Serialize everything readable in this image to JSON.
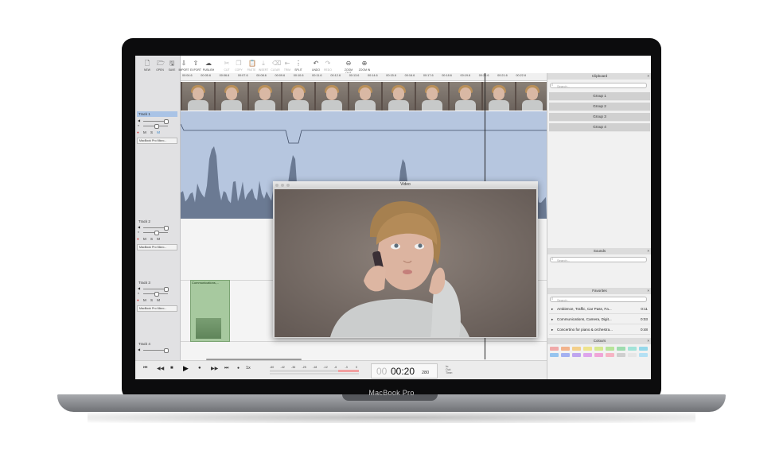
{
  "device": {
    "brand": "MacBook Pro"
  },
  "toolbar": [
    {
      "label": "NEW",
      "icon": "new-file-icon",
      "enabled": true
    },
    {
      "label": "OPEN",
      "icon": "open-file-icon",
      "enabled": true
    },
    {
      "label": "SAVE",
      "icon": "save-icon",
      "enabled": true
    },
    {
      "label": "IMPORT",
      "icon": "import-icon",
      "enabled": true
    },
    {
      "label": "EXPORT",
      "icon": "export-icon",
      "enabled": true
    },
    {
      "label": "PUBLISH",
      "icon": "publish-cloud-icon",
      "enabled": true
    },
    {
      "label": "CUT",
      "icon": "scissors-icon",
      "enabled": false
    },
    {
      "label": "COPY",
      "icon": "copy-icon",
      "enabled": false
    },
    {
      "label": "PASTE",
      "icon": "paste-icon",
      "enabled": false
    },
    {
      "label": "INSERT",
      "icon": "insert-icon",
      "enabled": false
    },
    {
      "label": "CLEAR",
      "icon": "clear-icon",
      "enabled": false
    },
    {
      "label": "TRIM",
      "icon": "trim-icon",
      "enabled": false
    },
    {
      "label": "SPLIT",
      "icon": "split-icon",
      "enabled": true
    },
    {
      "label": "UNDO",
      "icon": "undo-icon",
      "enabled": true
    },
    {
      "label": "REDO",
      "icon": "redo-icon",
      "enabled": false
    },
    {
      "label": "ZOOM OUT",
      "icon": "zoom-out-icon",
      "enabled": true
    },
    {
      "label": "ZOOM IN",
      "icon": "zoom-in-icon",
      "enabled": true
    }
  ],
  "ruler": [
    "00:04.6",
    "00:05.6",
    "00:06.6",
    "00:07.6",
    "00:08.6",
    "00:09.6",
    "00:10.6",
    "00:11.6",
    "00:12.6",
    "00:13.6",
    "00:14.6",
    "00:15.6",
    "00:16.6",
    "00:17.6",
    "00:18.6",
    "00:19.6",
    "00:20.6",
    "00:21.6",
    "00:22.6"
  ],
  "tracks": [
    {
      "title": "Track 1",
      "device": "MacBook Pro Micro...",
      "selected": true
    },
    {
      "title": "Track 2",
      "device": "MacBook Pro Micro...",
      "selected": false
    },
    {
      "title": "Track 3",
      "device": "MacBook Pro Micro...",
      "selected": false
    },
    {
      "title": "Track 4",
      "device": "",
      "selected": false
    }
  ],
  "track_buttons": {
    "record": "●",
    "mute": "M",
    "solo": "S",
    "monitor": "M"
  },
  "clip3": {
    "title": "Communications,..."
  },
  "video_window": {
    "title": "Video"
  },
  "clipboard": {
    "title": "Clipboard",
    "search_placeholder": "Search...",
    "groups": [
      "Group 1",
      "Group 2",
      "Group 3",
      "Group 4"
    ]
  },
  "sounds": {
    "title": "Sounds",
    "search_placeholder": "Search..."
  },
  "favorites": {
    "title": "Favorites",
    "search_placeholder": "Search...",
    "items": [
      {
        "name": "Ambience, Traffic, Car Pass, Fa...",
        "duration": "0:11"
      },
      {
        "name": "Communications, Camera, Digit...",
        "duration": "0:03"
      },
      {
        "name": "Concertino for piano & orchestra...",
        "duration": "0:48"
      }
    ]
  },
  "colours": {
    "title": "Colours",
    "swatches": [
      "#f0a9a9",
      "#f2b38c",
      "#f3cf8a",
      "#eee38c",
      "#d6e88e",
      "#b7e49a",
      "#9edcaf",
      "#a3e3d8",
      "#95d8ea",
      "#96c4ef",
      "#a3b0f1",
      "#bfa5ef",
      "#dea5ec",
      "#f0a5d8",
      "#f6b4c4",
      "#cfcfcf",
      "#e6e6e6",
      "#b4e0f4"
    ]
  },
  "transport": {
    "speed": "1x",
    "meter_ticks": [
      "-60",
      "-42",
      "-36",
      "-25",
      "-18",
      "-12",
      "-6",
      "-3",
      "0"
    ],
    "time_hours": "00",
    "time_main": "00:20",
    "time_ms": "280",
    "in_label": "In:",
    "out_label": "Out:",
    "time_label": "Time:"
  },
  "close_symbol": "×"
}
